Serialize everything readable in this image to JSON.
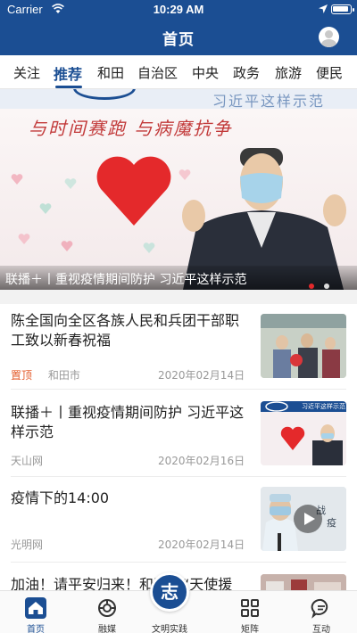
{
  "status_bar": {
    "carrier": "Carrier",
    "time": "10:29 AM"
  },
  "header": {
    "title": "首页"
  },
  "tabs": [
    {
      "label": "关注",
      "active": false
    },
    {
      "label": "推荐",
      "active": true
    },
    {
      "label": "和田",
      "active": false
    },
    {
      "label": "自治区",
      "active": false
    },
    {
      "label": "中央",
      "active": false
    },
    {
      "label": "政务",
      "active": false
    },
    {
      "label": "旅游",
      "active": false
    },
    {
      "label": "便民",
      "active": false
    }
  ],
  "banner": {
    "caption": "联播＋丨重视疫情期间防护 习近平这样示范",
    "slogan": "与时间赛跑 与病魔抗争",
    "ghost_text": "习近平这样示范",
    "slide_count": 2,
    "active_slide": 1
  },
  "news": [
    {
      "title": "陈全国向全区各族人民和兵团干部职工致以新春祝福",
      "pinned_label": "置顶",
      "source": "和田市",
      "date": "2020年02月14日",
      "has_video": false
    },
    {
      "title": "联播＋丨重视疫情期间防护 习近平这样示范",
      "pinned_label": "",
      "source": "天山网",
      "date": "2020年02月16日",
      "has_video": false,
      "thumb_text": "习近平这样示范"
    },
    {
      "title": "疫情下的14:00",
      "pinned_label": "",
      "source": "光明网",
      "date": "2020年02月14日",
      "has_video": true
    },
    {
      "title": "加油！请平安归来！和田的“天使援",
      "pinned_label": "",
      "source": "",
      "date": "",
      "has_video": false
    }
  ],
  "bottom_nav": [
    {
      "label": "首页",
      "icon": "home-icon",
      "active": true
    },
    {
      "label": "融媒",
      "icon": "media-icon",
      "active": false
    },
    {
      "label": "文明实践",
      "icon": "civilization-icon",
      "active": false
    },
    {
      "label": "矩阵",
      "icon": "matrix-icon",
      "active": false
    },
    {
      "label": "互动",
      "icon": "chat-icon",
      "active": false
    }
  ],
  "center_fab_text": "志",
  "colors": {
    "brand": "#1b4e93",
    "pinned": "#e35b2b",
    "heart": "#e4292b"
  }
}
